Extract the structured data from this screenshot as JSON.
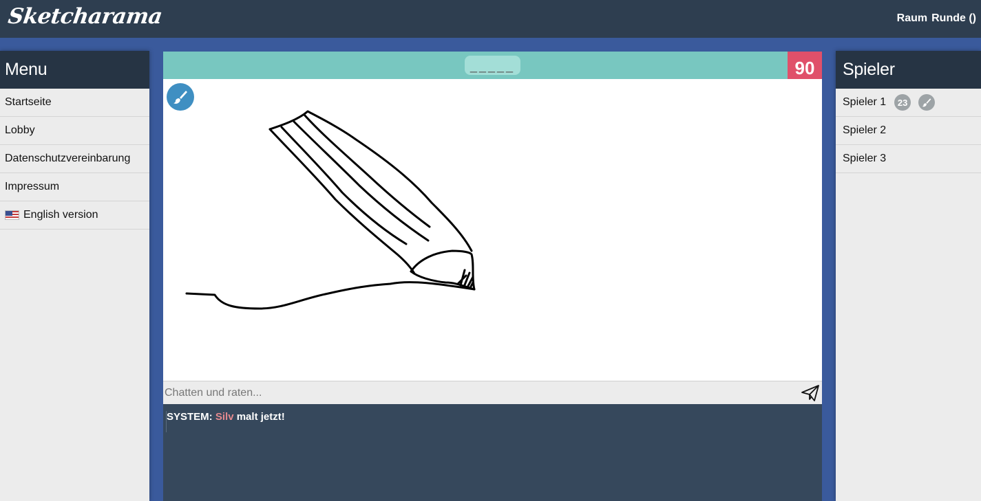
{
  "app": {
    "logo": "Sketcharama",
    "room_label": "Raum",
    "round_label": "Runde ()"
  },
  "menu": {
    "title": "Menu",
    "items": [
      {
        "label": "Startseite"
      },
      {
        "label": "Lobby"
      },
      {
        "label": "Datenschutzvereinbarung"
      },
      {
        "label": "Impressum"
      },
      {
        "label": "English version",
        "icon": "us-flag-icon"
      }
    ]
  },
  "game": {
    "word_hint": "_____",
    "timer": "90",
    "tool_icon": "paintbrush-icon"
  },
  "chat": {
    "placeholder": "Chatten und raten...",
    "send_icon": "paper-plane-icon",
    "messages": [
      {
        "prefix": "SYSTEM:",
        "name": "Silv",
        "text": "malt jetzt!"
      }
    ]
  },
  "players": {
    "title": "Spieler",
    "list": [
      {
        "name": "Spieler 1",
        "score": "23",
        "drawing": true
      },
      {
        "name": "Spieler 2"
      },
      {
        "name": "Spieler 3"
      }
    ]
  },
  "colors": {
    "topbar": "#2e3e50",
    "page_bg": "#3a5a9c",
    "word_bar": "#78c7c0",
    "timer": "#e0506a",
    "chat_bg": "#36485c",
    "player_name_in_chat": "#e68a8f",
    "tool_button": "#3f8fc2"
  }
}
